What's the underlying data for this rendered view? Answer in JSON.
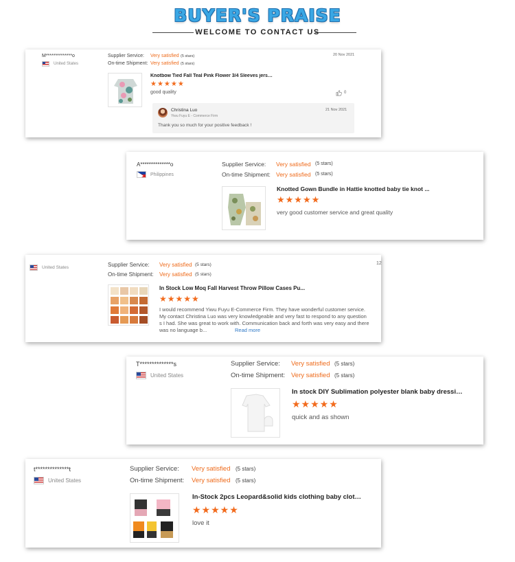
{
  "header": {
    "title": "BUYER'S PRAISE",
    "subtitle": "WELCOME TO CONTACT US"
  },
  "labels": {
    "supplier_service": "Supplier Service:",
    "ontime_shipment": "On-time Shipment:"
  },
  "colors": {
    "accent": "#ee6a1a",
    "title_blue": "#3aa7e4",
    "link": "#2f78c6"
  },
  "reviews": [
    {
      "name": "M**************o",
      "country": "United States",
      "flag": "us-flag",
      "supplier_rating": "Very satisfied",
      "supplier_stars": "(5 stars)",
      "shipment_rating": "Very satisfied",
      "shipment_stars": "(5 stars)",
      "date": "20 Nov 2021",
      "product_title": "Knotbow Tied Fall Teal Pink Flower 3/4 Sleeves jersey...",
      "stars": "★★★★★",
      "comment": "good quality",
      "likes": "0",
      "reply": {
        "name": "Christina Luo",
        "company": "Yiwu Fuyu E - Commerce Firm",
        "date": "21 Nov 2021",
        "text": "Thank you so much for your positive feedback !"
      }
    },
    {
      "name": "A**************o",
      "country": "Philippines",
      "flag": "philippines-flag",
      "supplier_rating": "Very satisfied",
      "supplier_stars": "(5 stars)",
      "shipment_rating": "Very satisfied",
      "shipment_stars": "(5 stars)",
      "product_title": "Knotted Gown Bundle in Hattie knotted baby tie knot ...",
      "stars": "★★★★★",
      "comment": "very good customer service and great quality"
    },
    {
      "country": "United States",
      "flag": "us-flag",
      "supplier_rating": "Very satisfied",
      "supplier_stars": "(5 stars)",
      "shipment_rating": "Very satisfied",
      "shipment_stars": "(5 stars)",
      "date": "12",
      "product_title": "In Stock Low Moq Fall Harvest Throw Pillow Cases Pu...",
      "stars": "★★★★★",
      "comment_lines": [
        "I would recommend Yiwu Fuyu E-Commerce Firm.  They have wonderful customer service.",
        "My contact Christina Luo was very knowledgeable and very fast to respond to any question",
        "s I had. She was great to work with. Communication back and forth was very easy and there",
        "was no language b..."
      ],
      "read_more": "Read more"
    },
    {
      "name": "T**************s",
      "country": "United States",
      "flag": "us-flag",
      "supplier_rating": "Very satisfied",
      "supplier_stars": "(5 stars)",
      "shipment_rating": "Very satisfied",
      "shipment_stars": "(5 stars)",
      "product_title": "In stock DIY Sublimation polyester blank baby dressin...",
      "stars": "★★★★★",
      "comment": "quick and as shown"
    },
    {
      "name": "t**************t",
      "country": "United States",
      "flag": "us-flag",
      "supplier_rating": "Very satisfied",
      "supplier_stars": "(5 stars)",
      "shipment_rating": "Very satisfied",
      "shipment_stars": "(5 stars)",
      "product_title": "In-Stock 2pcs Leopard&solid kids clothing baby cloth...",
      "stars": "★★★★★",
      "comment": "love it"
    }
  ]
}
